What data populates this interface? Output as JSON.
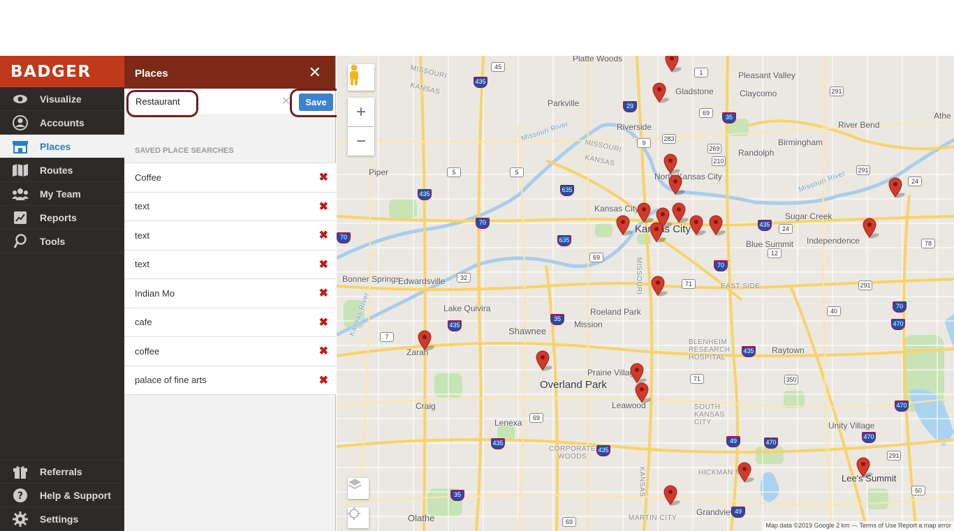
{
  "brand": {
    "name": "BADGER"
  },
  "nav": {
    "items": [
      {
        "label": "Visualize",
        "icon": "eye-icon"
      },
      {
        "label": "Accounts",
        "icon": "user-circle-icon"
      },
      {
        "label": "Places",
        "icon": "storefront-icon"
      },
      {
        "label": "Routes",
        "icon": "map-icon"
      },
      {
        "label": "My Team",
        "icon": "team-icon"
      },
      {
        "label": "Reports",
        "icon": "chart-icon"
      },
      {
        "label": "Tools",
        "icon": "wrench-icon"
      }
    ],
    "bottom": [
      {
        "label": "Referrals",
        "icon": "gift-icon"
      },
      {
        "label": "Help & Support",
        "icon": "help-icon"
      },
      {
        "label": "Settings",
        "icon": "gear-icon"
      }
    ]
  },
  "panel": {
    "title": "Places",
    "close": "✕",
    "search_value": "Restaurant",
    "save_label": "Save",
    "clear": "✕",
    "saved_heading": "SAVED PLACE SEARCHES",
    "saved": [
      "Coffee",
      "text",
      "text",
      "text",
      "Indian Mo",
      "cafe",
      "coffee",
      "palace of fine arts"
    ],
    "delete_glyph": "✖"
  },
  "map": {
    "labels": {
      "platte_woods": "Platte Woods",
      "gladstone": "Gladstone",
      "pleasant_valley": "Pleasant Valley",
      "claycomo": "Claycomo",
      "parkville": "Parkville",
      "riverside": "Riverside",
      "river_bend": "River Bend",
      "birmingham": "Birmingham",
      "randolph": "Randolph",
      "north_kc": "North Kansas City",
      "piper": "Piper",
      "kansas_city_ks": "Kansas City",
      "kansas_city": "Kansas City",
      "sugar_creek": "Sugar Creek",
      "blue_summit": "Blue Summit",
      "independence": "Independence",
      "bonner_springs": "Bonner Springs",
      "edwardsville": "Edwardsville",
      "lake_quivira": "Lake Quivira",
      "roeland_park": "Roeland Park",
      "mission": "Mission",
      "shawnee": "Shawnee",
      "east_side": "EAST SIDE",
      "raytown": "Raytown",
      "zaran": "Zaran",
      "prairie_village": "Prairie Village",
      "overland_park": "Overland Park",
      "leawood": "Leawood",
      "blenheim": "BLENHEIM RESEARCH HOSPITAL",
      "south_kc": "SOUTH KANSAS CITY",
      "craig": "Craig",
      "lenexa": "Lenexa",
      "corporate_woods": "CORPORATE WOODS",
      "unity_village": "Unity Village",
      "hickman_mills": "HICKMAN M",
      "lees_summit": "Lee's Summit",
      "grandview": "Grandview",
      "martin_city": "MARTIN CITY",
      "olathe": "Olathe",
      "missouri_river": "Missouri River",
      "kansas_river": "Kansas River",
      "missouri": "MISSOURI",
      "kansas": "KANSAS",
      "athe": "Athe"
    },
    "attribution": "Map data ©2019 Google   2 km ⎯⎯   Terms of Use   Report a map error"
  },
  "colors": {
    "brand": "#c0391b",
    "panel_header": "#7c2a17",
    "sidebar": "#2d2a27",
    "active": "#2d7fc1",
    "save": "#3b82d0",
    "pin": "#d23a2c"
  }
}
